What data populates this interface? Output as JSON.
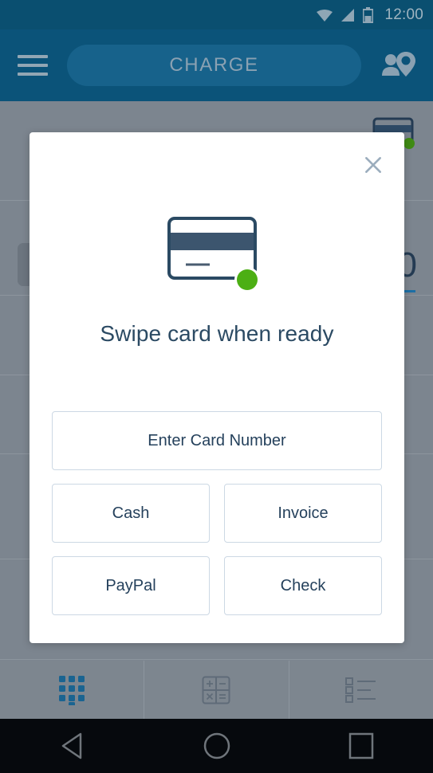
{
  "status_bar": {
    "time": "12:00",
    "icons": [
      "wifi-icon",
      "signal-icon",
      "battery-icon"
    ]
  },
  "app_bar": {
    "menu_icon": "hamburger-menu-icon",
    "charge_label": "CHARGE",
    "customer_icon": "person-location-pin-icon"
  },
  "background": {
    "card_icon": "credit-card-icon",
    "amount": "0",
    "dividers": [
      251,
      370,
      470,
      569,
      701
    ]
  },
  "modal": {
    "close_icon": "close-icon",
    "card_icon": "credit-card-swipe-icon",
    "title": "Swipe card when ready",
    "primary_option": "Enter Card Number",
    "options": [
      {
        "label": "Cash"
      },
      {
        "label": "Invoice"
      },
      {
        "label": "PayPal"
      },
      {
        "label": "Check"
      }
    ]
  },
  "bottom_bar": {
    "tabs": [
      {
        "name": "keypad-tab",
        "icon": "dialpad-icon",
        "active": true
      },
      {
        "name": "calculator-tab",
        "icon": "calculator-icon",
        "active": false
      },
      {
        "name": "list-tab",
        "icon": "list-icon",
        "active": false
      }
    ]
  },
  "nav_bar": {
    "buttons": [
      {
        "name": "back-button",
        "icon": "triangle-back-icon"
      },
      {
        "name": "home-button",
        "icon": "circle-home-icon"
      },
      {
        "name": "recents-button",
        "icon": "square-recents-icon"
      }
    ]
  },
  "colors": {
    "status_bar": "#0a4f70",
    "app_bar": "#0b5379",
    "pill": "#17628b",
    "backdrop": "#7c858f",
    "accent_green": "#4caf14",
    "text_dark": "#2b4a63",
    "border": "#ccd8e4"
  }
}
